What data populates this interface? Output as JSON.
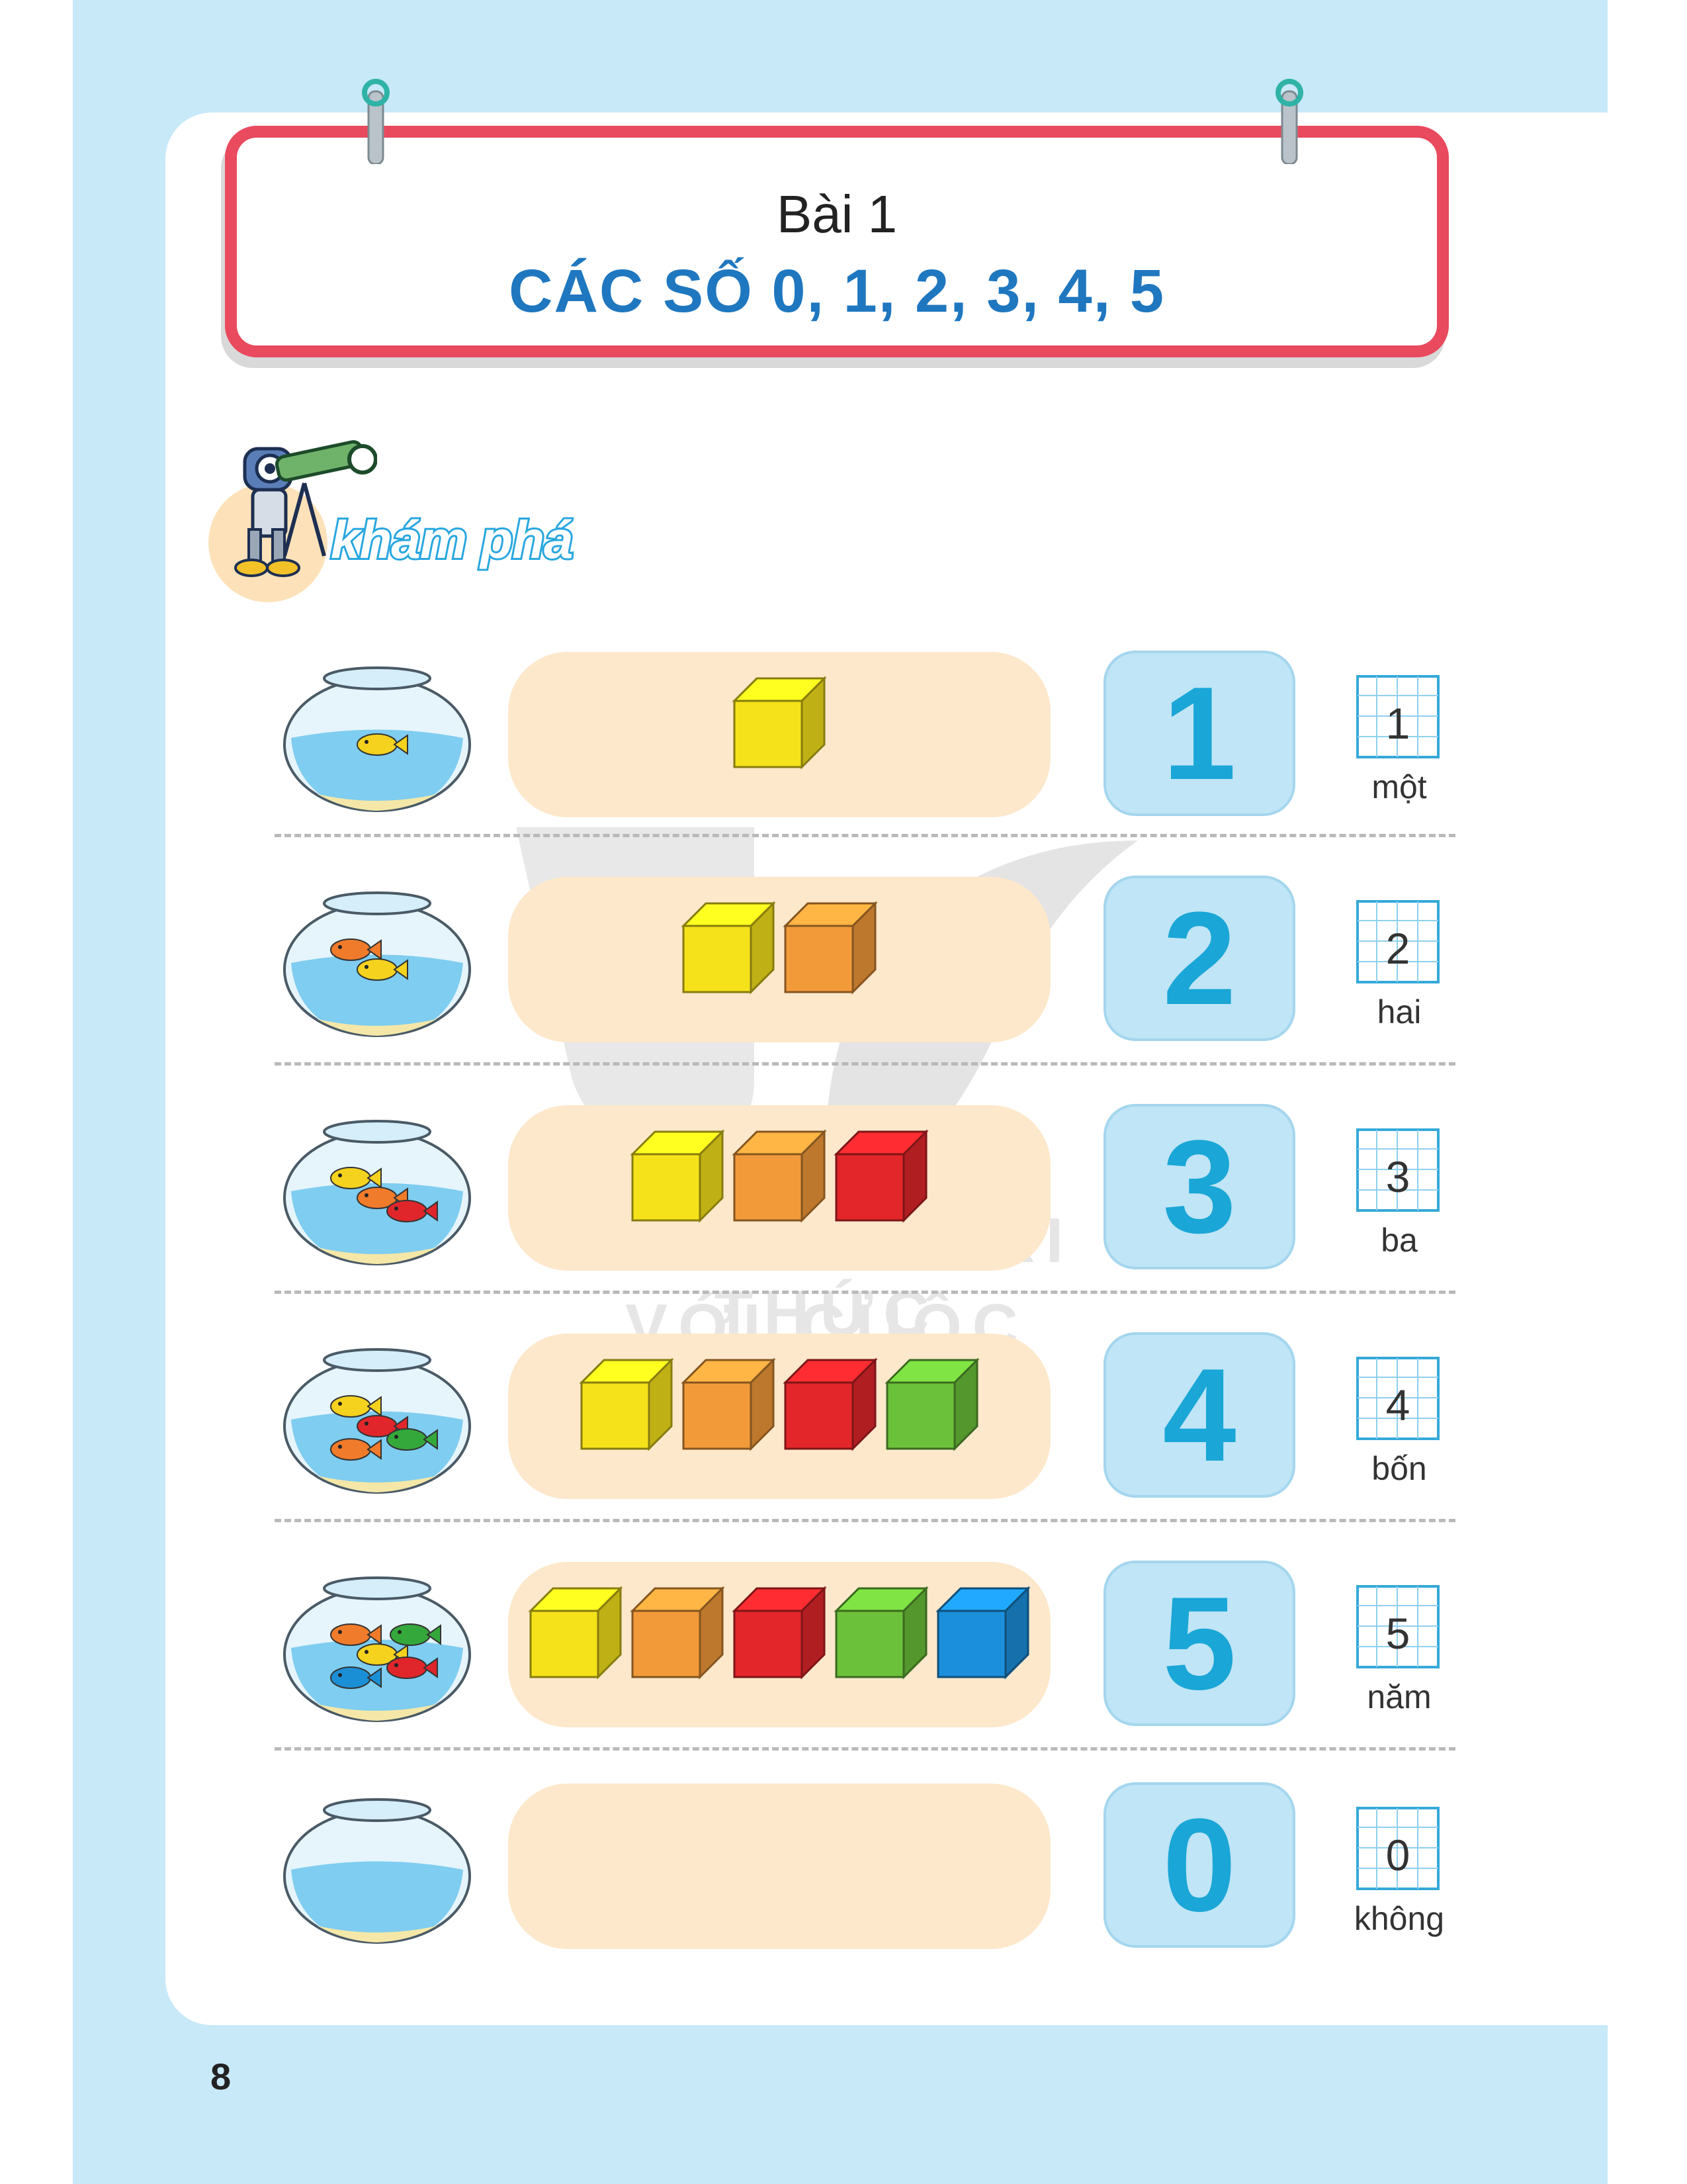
{
  "header": {
    "lesson_label": "Bài 1",
    "lesson_title": "CÁC SỐ 0, 1, 2, 3, 4, 5"
  },
  "section": {
    "label": "khám phá",
    "icon": "robot-telescope-icon"
  },
  "rows": [
    {
      "count": 1,
      "digit": "1",
      "word": "một",
      "fish_colors": [
        "#f4d21e"
      ],
      "cube_colors": [
        "#f5e21b"
      ]
    },
    {
      "count": 2,
      "digit": "2",
      "word": "hai",
      "fish_colors": [
        "#f4d21e",
        "#f07b2a"
      ],
      "cube_colors": [
        "#f5e21b",
        "#f29a3a"
      ]
    },
    {
      "count": 3,
      "digit": "3",
      "word": "ba",
      "fish_colors": [
        "#f07b2a",
        "#f4d21e",
        "#e0262b"
      ],
      "cube_colors": [
        "#f5e21b",
        "#f29a3a",
        "#e3262a"
      ]
    },
    {
      "count": 4,
      "digit": "4",
      "word": "bốn",
      "fish_colors": [
        "#e0262b",
        "#f4d21e",
        "#35a83b",
        "#f07b2a"
      ],
      "cube_colors": [
        "#f5e21b",
        "#f29a3a",
        "#e3262a",
        "#6cc13a"
      ]
    },
    {
      "count": 5,
      "digit": "5",
      "word": "năm",
      "fish_colors": [
        "#f4d21e",
        "#f07b2a",
        "#e0262b",
        "#1b8fd6",
        "#35a83b"
      ],
      "cube_colors": [
        "#f5e21b",
        "#f29a3a",
        "#e3262a",
        "#6cc13a",
        "#1c8fdc"
      ]
    },
    {
      "count": 0,
      "digit": "0",
      "word": "không",
      "fish_colors": [],
      "cube_colors": []
    }
  ],
  "watermark": {
    "line1": "KẾT NỐI TRI THỨC",
    "line2": "VỚI CUỘC SỐNG"
  },
  "page_number": "8",
  "colors": {
    "background": "#c8e9f8",
    "title_border": "#e94a5e",
    "title_text": "#1f77bf",
    "number_text": "#1aa6d6",
    "number_box": "#bfe5f6",
    "tray": "#fde8cb"
  }
}
